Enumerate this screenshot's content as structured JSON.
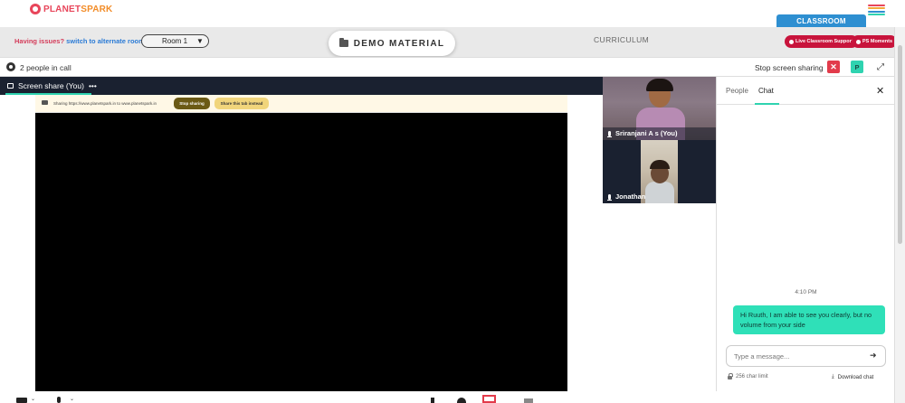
{
  "header": {
    "logo_text_a": "PLANET",
    "logo_text_b": "SPARK",
    "issues_text": "Having issues?",
    "switch_text": "switch to alternate room",
    "room_select": "Room 1",
    "demo_material": "DEMO MATERIAL",
    "curriculum": "CURRICULUM",
    "classroom": "CLASSROOM",
    "live_support": "Live Classroom Support",
    "ps_moments": "PS Moments",
    "hamburger_colors": [
      "#e8455a",
      "#f2a93b",
      "#2e8fd1",
      "#2fd3b0"
    ]
  },
  "meeting": {
    "people_count": "2 people in call",
    "stop_screen_sharing": "Stop screen sharing",
    "close_glyph": "✕",
    "presenter_initial": "P",
    "expand_glyph": "⤢"
  },
  "stage": {
    "tab_label": "Screen share (You)",
    "tab_more": "•••",
    "banner_text": "Sharing https://www.planetspark.in to www.planetspark.in",
    "stop_sharing": "Stop sharing",
    "share_tab_instead": "Share this tab instead"
  },
  "videos": [
    {
      "name": "Sriranjani A s (You)"
    },
    {
      "name": "Jonathan"
    }
  ],
  "chat": {
    "tab_people": "People",
    "tab_chat": "Chat",
    "close_glyph": "✕",
    "time": "4:10 PM",
    "message": "Hi Ruuth, I am able to see you clearly, but no volume from your side",
    "input_placeholder": "Type a message...",
    "send_glyph": "➜",
    "char_limit": "256 char limit",
    "download": "Download chat"
  },
  "colors": {
    "accent": "#2fd3b0",
    "danger": "#e23b4b",
    "brand_red": "#c8143c",
    "brand_blue": "#2e8fd1"
  }
}
